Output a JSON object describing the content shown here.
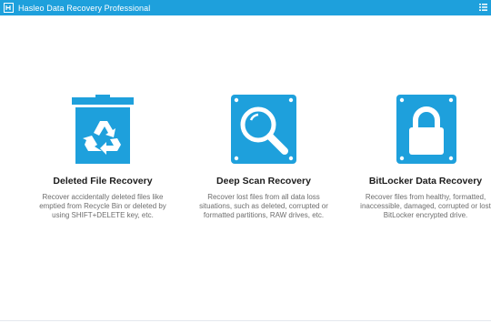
{
  "app": {
    "title": "Hasleo Data Recovery Professional",
    "accent_color": "#1ea0dc",
    "logo_icon": "hasleo-logo-icon",
    "menu_icon": "menu-list-icon"
  },
  "recovery_modes": [
    {
      "title": "Deleted File Recovery",
      "description": "Recover accidentally deleted files like\nemptied from Recycle Bin or deleted by\nusing SHIFT+DELETE key, etc.",
      "icon": "recycle-bin-icon"
    },
    {
      "title": "Deep Scan Recovery",
      "description": "Recover lost files from all data loss\nsituations, such as deleted, corrupted or\nformatted partitions, RAW drives, etc.",
      "icon": "magnifier-drive-icon"
    },
    {
      "title": "BitLocker Data Recovery",
      "description": "Recover files from healthy, formatted,\ninaccessible, damaged, corrupted or lost\nBitLocker encrypted drive.",
      "icon": "lock-drive-icon"
    }
  ]
}
